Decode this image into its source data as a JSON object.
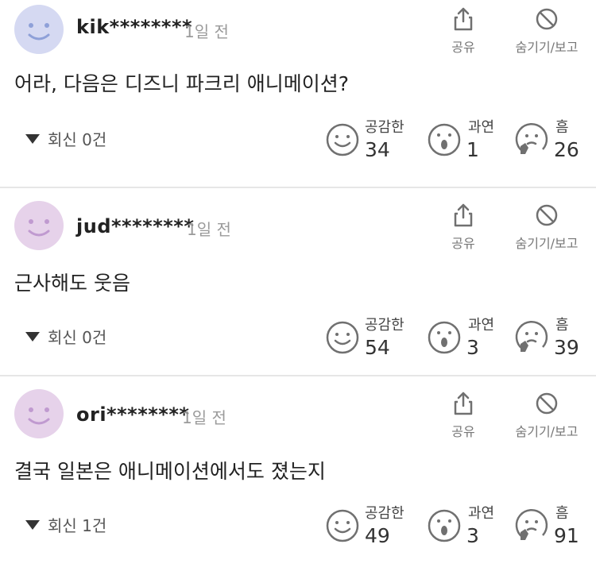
{
  "colors": {
    "avatar_blue": "#d5d9f2",
    "avatar_pink": "#e6d2ea",
    "avatar_blue_feature": "#8ea0d8",
    "avatar_pink_feature": "#c09ad0",
    "icon_gray": "#707070"
  },
  "labels": {
    "share": "공유",
    "hide_report": "숨기기/보고",
    "react_empathy": "공감한",
    "react_surprise": "과연",
    "react_hmm": "흠"
  },
  "comments": [
    {
      "username": "kik********",
      "time": "1일 전",
      "text": "어라, 다음은 디즈니 파크리 애니메이션?",
      "replies": "회신 0건",
      "avatar_color": "blue",
      "empathy": "34",
      "surprise": "1",
      "hmm": "26"
    },
    {
      "username": "jud********",
      "time": "1일 전",
      "text": "근사해도 웃음",
      "replies": "회신 0건",
      "avatar_color": "pink",
      "empathy": "54",
      "surprise": "3",
      "hmm": "39"
    },
    {
      "username": "ori********",
      "time": "1일 전",
      "text": "결국 일본은 애니메이션에서도 졌는지",
      "replies": "회신 1건",
      "avatar_color": "pink",
      "empathy": "49",
      "surprise": "3",
      "hmm": "91"
    }
  ]
}
